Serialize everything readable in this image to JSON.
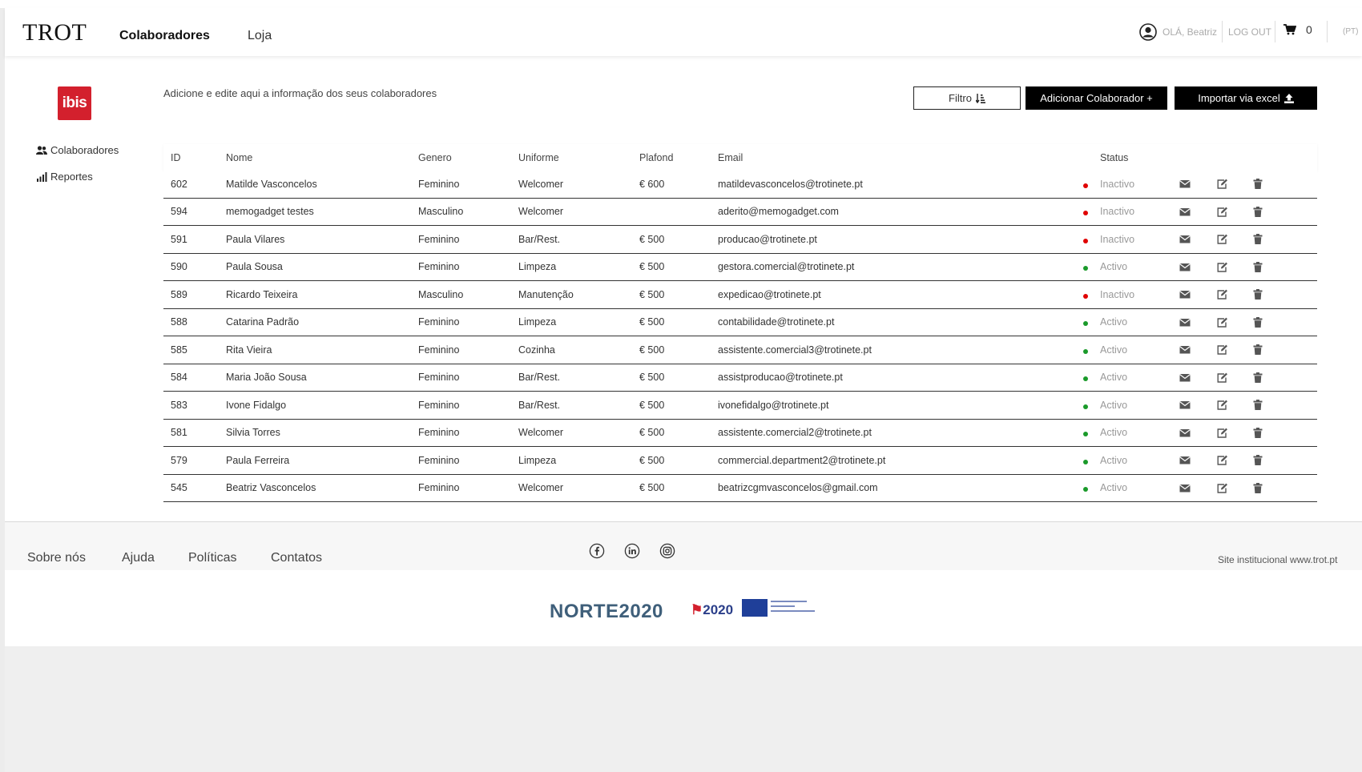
{
  "header": {
    "logo": "TROT",
    "nav": [
      "Colaboradores",
      "Loja"
    ],
    "greeting": "OLÁ, Beatriz",
    "logout": "LOG OUT",
    "cart_count": "0",
    "language": "(PT)"
  },
  "sidebar": {
    "brand": "ibis",
    "items": [
      {
        "label": "Colaboradores",
        "icon": "users-icon"
      },
      {
        "label": "Reportes",
        "icon": "bar-chart-icon"
      }
    ]
  },
  "main": {
    "intro": "Adicione e edite aqui a informação dos seus colaboradores",
    "buttons": {
      "filter": "Filtro",
      "add": "Adicionar Colaborador +",
      "import": "Importar via excel"
    }
  },
  "table": {
    "headers": [
      "ID",
      "Nome",
      "Genero",
      "Uniforme",
      "Plafond",
      "Email",
      "Status"
    ],
    "rows": [
      {
        "id": "602",
        "nome": "Matilde Vasconcelos",
        "genero": "Feminino",
        "uniforme": "Welcomer",
        "plafond": "€ 600",
        "email": "matildevasconcelos@trotinete.pt",
        "status": "Inactivo",
        "status_color": "#e00000"
      },
      {
        "id": "594",
        "nome": "memogadget testes",
        "genero": "Masculino",
        "uniforme": "Welcomer",
        "plafond": "",
        "email": "aderito@memogadget.com",
        "status": "Inactivo",
        "status_color": "#e00000"
      },
      {
        "id": "591",
        "nome": "Paula Vilares",
        "genero": "Feminino",
        "uniforme": "Bar/Rest.",
        "plafond": "€ 500",
        "email": "producao@trotinete.pt",
        "status": "Inactivo",
        "status_color": "#e00000"
      },
      {
        "id": "590",
        "nome": "Paula Sousa",
        "genero": "Feminino",
        "uniforme": "Limpeza",
        "plafond": "€ 500",
        "email": "gestora.comercial@trotinete.pt",
        "status": "Activo",
        "status_color": "#1a9a2a"
      },
      {
        "id": "589",
        "nome": "Ricardo Teixeira",
        "genero": "Masculino",
        "uniforme": "Manutenção",
        "plafond": "€ 500",
        "email": "expedicao@trotinete.pt",
        "status": "Inactivo",
        "status_color": "#e00000"
      },
      {
        "id": "588",
        "nome": "Catarina Padrão",
        "genero": "Feminino",
        "uniforme": "Limpeza",
        "plafond": "€ 500",
        "email": "contabilidade@trotinete.pt",
        "status": "Activo",
        "status_color": "#1a9a2a"
      },
      {
        "id": "585",
        "nome": "Rita Vieira",
        "genero": "Feminino",
        "uniforme": "Cozinha",
        "plafond": "€ 500",
        "email": "assistente.comercial3@trotinete.pt",
        "status": "Activo",
        "status_color": "#1a9a2a"
      },
      {
        "id": "584",
        "nome": "Maria João Sousa",
        "genero": "Feminino",
        "uniforme": "Bar/Rest.",
        "plafond": "€ 500",
        "email": "assistproducao@trotinete.pt",
        "status": "Activo",
        "status_color": "#1a9a2a"
      },
      {
        "id": "583",
        "nome": "Ivone Fidalgo",
        "genero": "Feminino",
        "uniforme": "Bar/Rest.",
        "plafond": "€ 500",
        "email": "ivonefidalgo@trotinete.pt",
        "status": "Activo",
        "status_color": "#1a9a2a"
      },
      {
        "id": "581",
        "nome": "Silvia Torres",
        "genero": "Feminino",
        "uniforme": "Welcomer",
        "plafond": "€ 500",
        "email": "assistente.comercial2@trotinete.pt",
        "status": "Activo",
        "status_color": "#1a9a2a"
      },
      {
        "id": "579",
        "nome": "Paula Ferreira",
        "genero": "Feminino",
        "uniforme": "Limpeza",
        "plafond": "€ 500",
        "email": "commercial.department2@trotinete.pt",
        "status": "Activo",
        "status_color": "#1a9a2a"
      },
      {
        "id": "545",
        "nome": "Beatriz Vasconcelos",
        "genero": "Feminino",
        "uniforme": "Welcomer",
        "plafond": "€ 500",
        "email": "beatrizcgmvasconcelos@gmail.com",
        "status": "Activo",
        "status_color": "#1a9a2a"
      }
    ]
  },
  "footer": {
    "links": [
      "Sobre nós",
      "Ajuda",
      "Políticas",
      "Contatos"
    ],
    "social": [
      "facebook-icon",
      "linkedin-icon",
      "instagram-icon"
    ],
    "site": "Site institucional www.trot.pt",
    "sponsor_norte": "NORTE2020",
    "sponsor_pt": "2020"
  }
}
